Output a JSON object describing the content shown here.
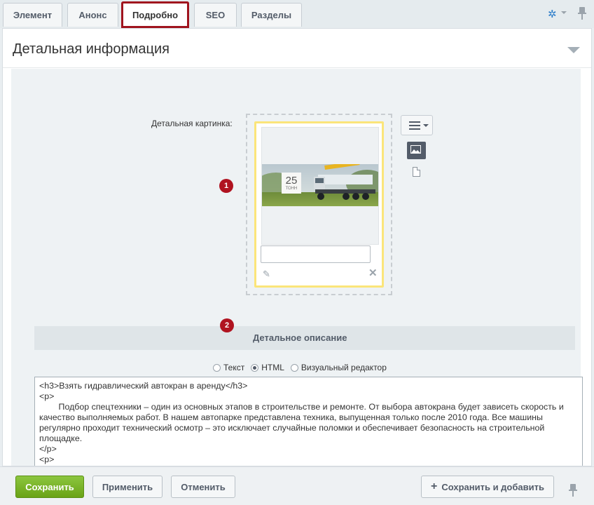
{
  "tabs": [
    {
      "label": "Элемент"
    },
    {
      "label": "Анонс"
    },
    {
      "label": "Подробно"
    },
    {
      "label": "SEO"
    },
    {
      "label": "Разделы"
    }
  ],
  "section": {
    "title": "Детальная информация"
  },
  "detail_picture": {
    "label": "Детальная картинка:",
    "photo_badge_top": "25",
    "photo_badge_bottom": "ТОНН",
    "description_value": ""
  },
  "markers": [
    "1",
    "2"
  ],
  "description": {
    "title": "Детальное описание",
    "modes": [
      {
        "label": "Текст",
        "checked": false
      },
      {
        "label": "HTML",
        "checked": true
      },
      {
        "label": "Визуальный редактор",
        "checked": false
      }
    ],
    "html": "<h3>Взять гидравлический автокран в аренду</h3>\n<p>\n\tПодбор спецтехники – один из основных этапов в строительстве и ремонте. От выбора автокрана будет зависеть скорость и качество выполняемых работ. В нашем автопарке представлена техника, выпущенная только после 2010 года. Все машины регулярно проходит технический осмотр – это исключает случайные поломки и обеспечивает безопасность на строительной площадке.\n</p>\n<p>\n\tЕсли в вашем штате нет профессиональных водителей, то арендуйте спецтехнику вместе со специалистами. Квалифицированные операторы и водители со стажем от 7 лет легко справятся с многотоннажными машинами и помогут выполнить строительные и погрзочно-разгрузочные работы.\n</p>"
  },
  "footer": {
    "save": "Сохранить",
    "apply": "Применить",
    "cancel": "Отменить",
    "save_and_add": "Сохранить и добавить"
  },
  "colors": {
    "active_tab_outline": "#a0141e",
    "badge": "#b01320",
    "save_button": "#6eaa1c",
    "image_highlight": "#fbe57a"
  }
}
